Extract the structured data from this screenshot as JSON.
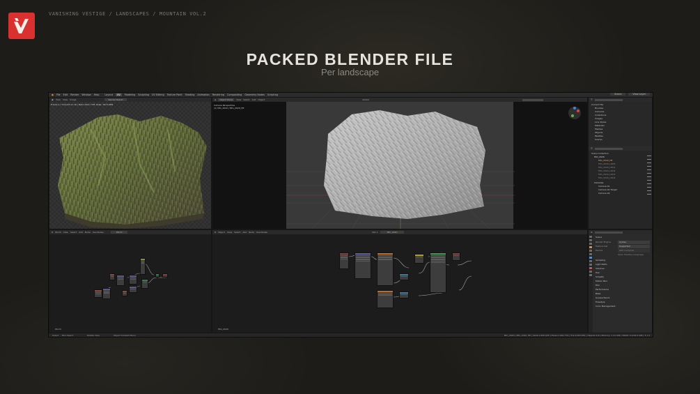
{
  "breadcrumb": "VANISHING VESTIGE / LANDSCAPES / MOUNTAIN VOL.2",
  "heading": "PACKED BLENDER FILE",
  "subheading": "Per landscape",
  "colors": {
    "brand": "#d8312f",
    "background": "#1e1d19",
    "title": "#e7e4dc"
  },
  "blender": {
    "menu": [
      "File",
      "Edit",
      "Render",
      "Window",
      "Help"
    ],
    "workspaces": [
      "Layout",
      "Modeling",
      "Sculpting",
      "UV Editing",
      "Texture Paint",
      "Shading",
      "Animation",
      "Rendering",
      "Compositing",
      "Geometry Nodes",
      "Scripting"
    ],
    "active_workspace": "UV",
    "scene_label": "Scene",
    "view_layer_label": "View Layer",
    "render_header": [
      "View",
      "View",
      "Image"
    ],
    "render_slot": "Render Result",
    "render_info": "Frame:1 | Time:00:11.16 | Mem:1021.77M, Peak: 1674.06M",
    "viewport_header": [
      "Object Mode",
      "View",
      "Select",
      "Add",
      "Object"
    ],
    "viewport_shading": "Global",
    "camera_label": "Camera Perspective",
    "camera_object": "(1) Mtn_2020 | Mtn_2020_HP",
    "outliner": {
      "data_api_title": "Current File",
      "data_items": [
        "Brushes",
        "Cameras",
        "Collections",
        "Images",
        "Line Styles",
        "Materials",
        "Meshes",
        "Objects",
        "Palettes",
        "Scenes"
      ],
      "scene_collection": "Scene Collection",
      "items": [
        "Mtn_2020",
        "Mtn_2020_HP",
        "Mtn_2020_LOD0",
        "Mtn_2020_LOD1",
        "Mtn_2020_LOD2",
        "Mtn_2020_LOD3",
        "Mtn_2020_LOD4",
        "Cameras",
        "Camera.01",
        "Camera.01.Target",
        "Camera.02"
      ]
    },
    "properties": {
      "scene": "Scene",
      "render_engine_label": "Render Engine",
      "render_engine": "Cycles",
      "feature_set_label": "Feature Set",
      "feature_set": "Supported",
      "device_label": "Device",
      "device": "GPU Compute",
      "note": "Open Shading Language",
      "sections": [
        "Sampling",
        "Light Paths",
        "Volumes",
        "Hair",
        "Simplify",
        "Motion Blur",
        "Film",
        "Performance",
        "Bake",
        "Grease Pencil",
        "Freestyle",
        "Color Management"
      ]
    },
    "node_left": {
      "header": [
        "World",
        "View",
        "Select",
        "Add",
        "Node"
      ],
      "use_nodes": "Use Nodes",
      "world": "World",
      "footer_label": "World"
    },
    "node_right": {
      "header": [
        "Object",
        "View",
        "Select",
        "Add",
        "Node"
      ],
      "use_nodes": "Use Nodes",
      "slot": "Slot 1",
      "material": "Mtn_2020",
      "footer_label": "Mtn_2020"
    },
    "status_left": [
      "Select",
      "Box Select",
      "Rotate View",
      "Object Context Menu"
    ],
    "status_right": "Mtn_2020 | Mtn_2020_HP | Verts:1,005,025 | Faces:1,001,776 | Tris:2,003,552 | Objects:1/9 | Memory: 1.21 GiB | VRAM: 4.2/24.0 GiB | 3.1.2"
  }
}
